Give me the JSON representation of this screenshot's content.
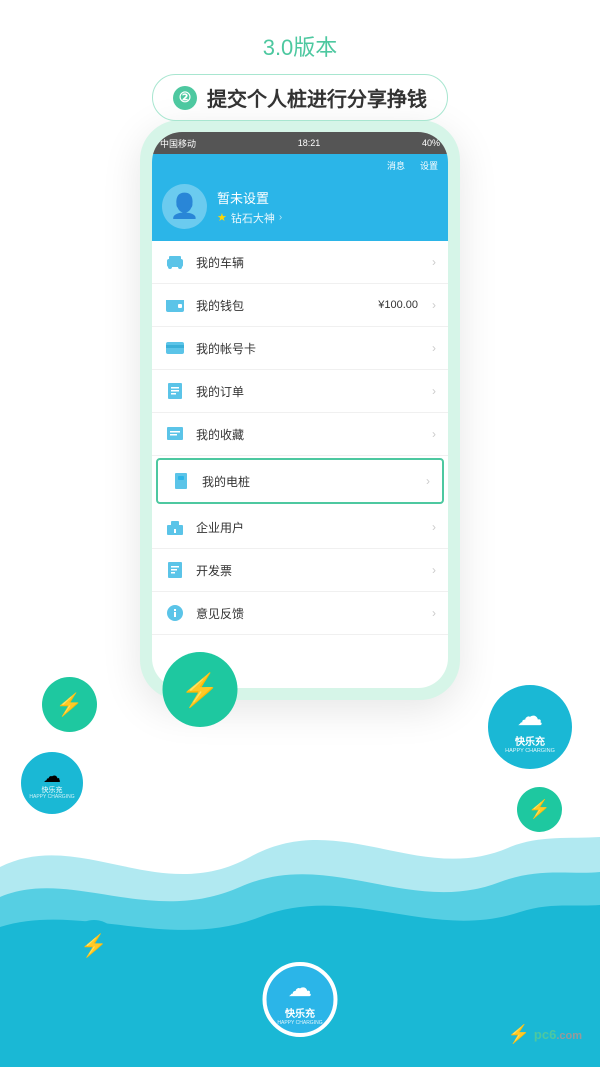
{
  "version": {
    "text": "3.0版本"
  },
  "subtitle": {
    "number": "②",
    "text": "提交个人桩进行分享挣钱"
  },
  "status_bar": {
    "carrier": "中国移动",
    "time": "18:21",
    "battery": "40%"
  },
  "app_header": {
    "message_label": "消息",
    "settings_label": "设置",
    "user_name": "暂未设置",
    "user_badge": "钻石大神",
    "chevron": ">"
  },
  "menu_items": [
    {
      "icon": "car-icon",
      "label": "我的车辆",
      "value": "",
      "highlighted": false
    },
    {
      "icon": "wallet-icon",
      "label": "我的钱包",
      "value": "¥100.00",
      "highlighted": false
    },
    {
      "icon": "card-icon",
      "label": "我的帐号卡",
      "value": "",
      "highlighted": false
    },
    {
      "icon": "order-icon",
      "label": "我的订单",
      "value": "",
      "highlighted": false
    },
    {
      "icon": "collect-icon",
      "label": "我的收藏",
      "value": "",
      "highlighted": false
    },
    {
      "icon": "pile-icon",
      "label": "我的电桩",
      "value": "",
      "highlighted": true
    },
    {
      "icon": "enterprise-icon",
      "label": "企业用户",
      "value": "",
      "highlighted": false
    },
    {
      "icon": "invoice-icon",
      "label": "开发票",
      "value": "",
      "highlighted": false
    },
    {
      "icon": "feedback-icon",
      "label": "意见反馈",
      "value": "",
      "highlighted": false
    }
  ],
  "logo": {
    "app_name": "快乐充",
    "tagline": "HAPPY CHARGING"
  },
  "watermark": {
    "site": "pс6.com"
  }
}
